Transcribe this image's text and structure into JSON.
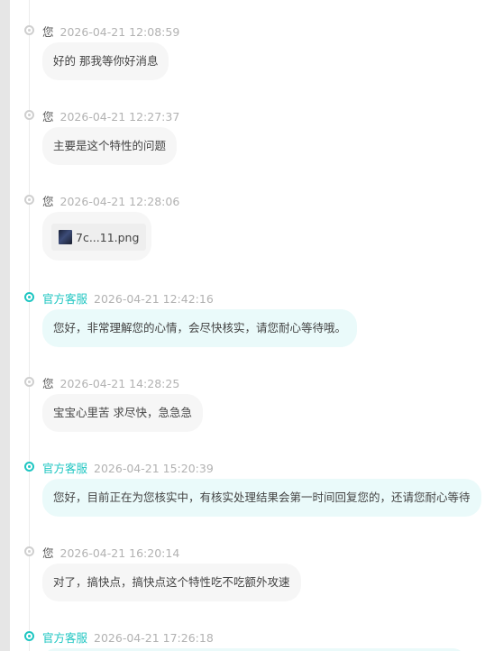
{
  "colors": {
    "accent": "#1ec6c2",
    "user_dot": "#cfcfcf",
    "staff_bubble": "#eafafa",
    "user_bubble": "#f6f6f6"
  },
  "messages": [
    {
      "sender": "您",
      "time": "2026-04-21 12:08:59",
      "text": "好的 那我等你好消息"
    },
    {
      "sender": "您",
      "time": "2026-04-21 12:27:37",
      "text": "主要是这个特性的问题"
    },
    {
      "sender": "您",
      "time": "2026-04-21 12:28:06",
      "file_name": "7c...11.png",
      "file_icon": "image-thumbnail-icon"
    },
    {
      "sender": "官方客服",
      "time": "2026-04-21 12:42:16",
      "text": "您好，非常理解您的心情，会尽快核实，请您耐心等待哦。"
    },
    {
      "sender": "您",
      "time": "2026-04-21 14:28:25",
      "text": "宝宝心里苦 求尽快，急急急"
    },
    {
      "sender": "官方客服",
      "time": "2026-04-21 15:20:39",
      "text": "您好，目前正在为您核实中，有核实处理结果会第一时间回复您的，还请您耐心等待"
    },
    {
      "sender": "您",
      "time": "2026-04-21 16:20:14",
      "text": "对了，搞快点，搞快点这个特性吃不吃额外攻速"
    },
    {
      "sender": "官方客服",
      "time": "2026-04-21 17:26:18",
      "text": ""
    }
  ]
}
